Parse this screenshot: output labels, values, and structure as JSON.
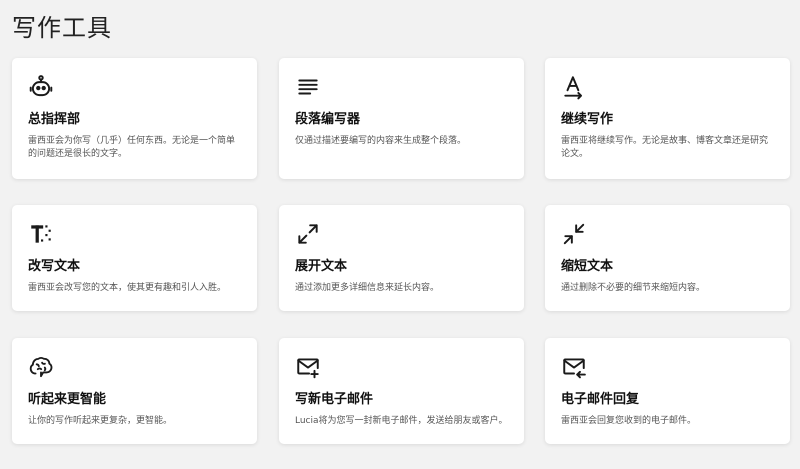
{
  "page": {
    "title": "写作工具"
  },
  "cards": [
    {
      "title": "总指挥部",
      "desc": "雷西亚会为你写（几乎）任何东西。无论是一个简单的问题还是很长的文字。",
      "icon": "robot-icon"
    },
    {
      "title": "段落编写器",
      "desc": "仅通过描述要编写的内容来生成整个段落。",
      "icon": "paragraph-lines-icon"
    },
    {
      "title": "继续写作",
      "desc": "雷西亚将继续写作。无论是故事、博客文章还是研究论文。",
      "icon": "text-continue-icon"
    },
    {
      "title": "改写文本",
      "desc": "雷西亚会改写您的文本，使其更有趣和引人入胜。",
      "icon": "rewrite-text-icon"
    },
    {
      "title": "展开文本",
      "desc": "通过添加更多详细信息来延长内容。",
      "icon": "expand-arrows-icon"
    },
    {
      "title": "缩短文本",
      "desc": "通过删除不必要的细节来缩短内容。",
      "icon": "shrink-arrows-icon"
    },
    {
      "title": "听起来更智能",
      "desc": "让你的写作听起来更复杂，更智能。",
      "icon": "brain-icon"
    },
    {
      "title": "写新电子邮件",
      "desc": "Lucia将为您写一封新电子邮件，发送给朋友或客户。",
      "icon": "mail-plus-icon"
    },
    {
      "title": "电子邮件回复",
      "desc": "雷西亚会回复您收到的电子邮件。",
      "icon": "mail-reply-icon"
    }
  ]
}
